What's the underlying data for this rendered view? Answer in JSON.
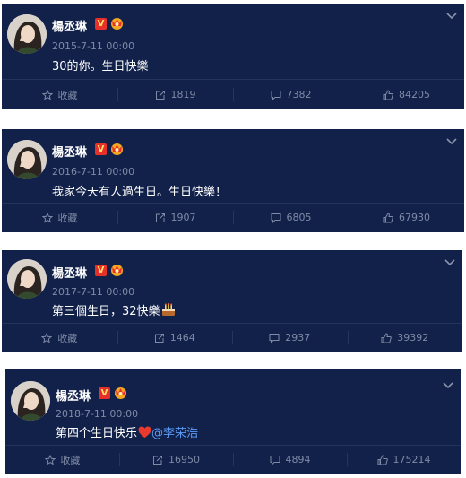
{
  "posts": [
    {
      "author": "楊丞琳",
      "timestamp": "2015-7-11 00:00",
      "content": "30的你。生日快樂",
      "emoji": "",
      "mention": "",
      "actions": {
        "favorite_label": "收藏",
        "repost_count": "1819",
        "comment_count": "7382",
        "like_count": "84205"
      }
    },
    {
      "author": "楊丞琳",
      "timestamp": "2016-7-11 00:00",
      "content": "我家今天有人過生日。生日快樂！",
      "emoji": "",
      "mention": "",
      "actions": {
        "favorite_label": "收藏",
        "repost_count": "1907",
        "comment_count": "6805",
        "like_count": "67930"
      }
    },
    {
      "author": "楊丞琳",
      "timestamp": "2017-7-11 00:00",
      "content": "第三個生日，32快樂",
      "emoji": "cake-icon",
      "mention": "",
      "actions": {
        "favorite_label": "收藏",
        "repost_count": "1464",
        "comment_count": "2937",
        "like_count": "39392"
      }
    },
    {
      "author": "楊丞琳",
      "timestamp": "2018-7-11 00:00",
      "content": "第四个生日快乐",
      "emoji": "red-heart-icon",
      "mention": "@李荣浩",
      "actions": {
        "favorite_label": "收藏",
        "repost_count": "16950",
        "comment_count": "4894",
        "like_count": "175214"
      }
    }
  ],
  "colors": {
    "card_background": "#12214a",
    "name_text": "#ffffff",
    "meta_text": "#7f8aa6",
    "mention_link": "#5b9bf7",
    "verified_badge": "#e8302a"
  },
  "icons": [
    "avatar",
    "verified-v-icon",
    "crown-badge-icon",
    "chevron-down-icon",
    "star-icon",
    "repost-icon",
    "comment-icon",
    "thumbs-up-icon"
  ]
}
